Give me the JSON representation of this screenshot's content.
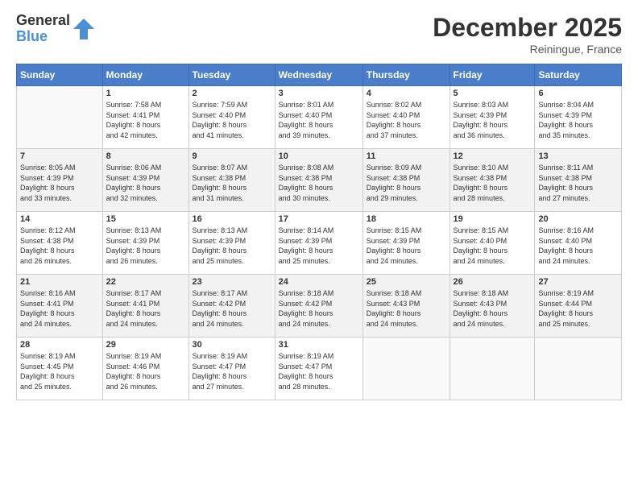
{
  "logo": {
    "general": "General",
    "blue": "Blue"
  },
  "title": {
    "month": "December 2025",
    "location": "Reiningue, France"
  },
  "days_header": [
    "Sunday",
    "Monday",
    "Tuesday",
    "Wednesday",
    "Thursday",
    "Friday",
    "Saturday"
  ],
  "weeks": [
    [
      {
        "num": "",
        "info": ""
      },
      {
        "num": "1",
        "info": "Sunrise: 7:58 AM\nSunset: 4:41 PM\nDaylight: 8 hours\nand 42 minutes."
      },
      {
        "num": "2",
        "info": "Sunrise: 7:59 AM\nSunset: 4:40 PM\nDaylight: 8 hours\nand 41 minutes."
      },
      {
        "num": "3",
        "info": "Sunrise: 8:01 AM\nSunset: 4:40 PM\nDaylight: 8 hours\nand 39 minutes."
      },
      {
        "num": "4",
        "info": "Sunrise: 8:02 AM\nSunset: 4:40 PM\nDaylight: 8 hours\nand 37 minutes."
      },
      {
        "num": "5",
        "info": "Sunrise: 8:03 AM\nSunset: 4:39 PM\nDaylight: 8 hours\nand 36 minutes."
      },
      {
        "num": "6",
        "info": "Sunrise: 8:04 AM\nSunset: 4:39 PM\nDaylight: 8 hours\nand 35 minutes."
      }
    ],
    [
      {
        "num": "7",
        "info": "Sunrise: 8:05 AM\nSunset: 4:39 PM\nDaylight: 8 hours\nand 33 minutes."
      },
      {
        "num": "8",
        "info": "Sunrise: 8:06 AM\nSunset: 4:39 PM\nDaylight: 8 hours\nand 32 minutes."
      },
      {
        "num": "9",
        "info": "Sunrise: 8:07 AM\nSunset: 4:38 PM\nDaylight: 8 hours\nand 31 minutes."
      },
      {
        "num": "10",
        "info": "Sunrise: 8:08 AM\nSunset: 4:38 PM\nDaylight: 8 hours\nand 30 minutes."
      },
      {
        "num": "11",
        "info": "Sunrise: 8:09 AM\nSunset: 4:38 PM\nDaylight: 8 hours\nand 29 minutes."
      },
      {
        "num": "12",
        "info": "Sunrise: 8:10 AM\nSunset: 4:38 PM\nDaylight: 8 hours\nand 28 minutes."
      },
      {
        "num": "13",
        "info": "Sunrise: 8:11 AM\nSunset: 4:38 PM\nDaylight: 8 hours\nand 27 minutes."
      }
    ],
    [
      {
        "num": "14",
        "info": "Sunrise: 8:12 AM\nSunset: 4:38 PM\nDaylight: 8 hours\nand 26 minutes."
      },
      {
        "num": "15",
        "info": "Sunrise: 8:13 AM\nSunset: 4:39 PM\nDaylight: 8 hours\nand 26 minutes."
      },
      {
        "num": "16",
        "info": "Sunrise: 8:13 AM\nSunset: 4:39 PM\nDaylight: 8 hours\nand 25 minutes."
      },
      {
        "num": "17",
        "info": "Sunrise: 8:14 AM\nSunset: 4:39 PM\nDaylight: 8 hours\nand 25 minutes."
      },
      {
        "num": "18",
        "info": "Sunrise: 8:15 AM\nSunset: 4:39 PM\nDaylight: 8 hours\nand 24 minutes."
      },
      {
        "num": "19",
        "info": "Sunrise: 8:15 AM\nSunset: 4:40 PM\nDaylight: 8 hours\nand 24 minutes."
      },
      {
        "num": "20",
        "info": "Sunrise: 8:16 AM\nSunset: 4:40 PM\nDaylight: 8 hours\nand 24 minutes."
      }
    ],
    [
      {
        "num": "21",
        "info": "Sunrise: 8:16 AM\nSunset: 4:41 PM\nDaylight: 8 hours\nand 24 minutes."
      },
      {
        "num": "22",
        "info": "Sunrise: 8:17 AM\nSunset: 4:41 PM\nDaylight: 8 hours\nand 24 minutes."
      },
      {
        "num": "23",
        "info": "Sunrise: 8:17 AM\nSunset: 4:42 PM\nDaylight: 8 hours\nand 24 minutes."
      },
      {
        "num": "24",
        "info": "Sunrise: 8:18 AM\nSunset: 4:42 PM\nDaylight: 8 hours\nand 24 minutes."
      },
      {
        "num": "25",
        "info": "Sunrise: 8:18 AM\nSunset: 4:43 PM\nDaylight: 8 hours\nand 24 minutes."
      },
      {
        "num": "26",
        "info": "Sunrise: 8:18 AM\nSunset: 4:43 PM\nDaylight: 8 hours\nand 24 minutes."
      },
      {
        "num": "27",
        "info": "Sunrise: 8:19 AM\nSunset: 4:44 PM\nDaylight: 8 hours\nand 25 minutes."
      }
    ],
    [
      {
        "num": "28",
        "info": "Sunrise: 8:19 AM\nSunset: 4:45 PM\nDaylight: 8 hours\nand 25 minutes."
      },
      {
        "num": "29",
        "info": "Sunrise: 8:19 AM\nSunset: 4:46 PM\nDaylight: 8 hours\nand 26 minutes."
      },
      {
        "num": "30",
        "info": "Sunrise: 8:19 AM\nSunset: 4:47 PM\nDaylight: 8 hours\nand 27 minutes."
      },
      {
        "num": "31",
        "info": "Sunrise: 8:19 AM\nSunset: 4:47 PM\nDaylight: 8 hours\nand 28 minutes."
      },
      {
        "num": "",
        "info": ""
      },
      {
        "num": "",
        "info": ""
      },
      {
        "num": "",
        "info": ""
      }
    ]
  ]
}
